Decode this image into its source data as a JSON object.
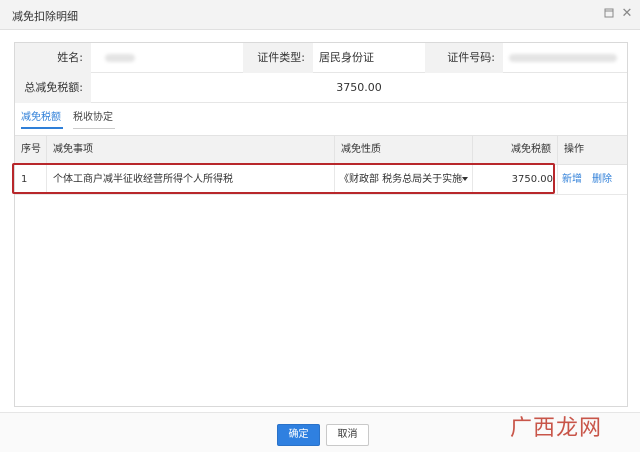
{
  "window": {
    "title": "减免扣除明细"
  },
  "info": {
    "name_label": "姓名:",
    "name_value": "",
    "id_type_label": "证件类型:",
    "id_type_value": "居民身份证",
    "id_number_label": "证件号码:",
    "id_number_value": "",
    "total_label": "总减免税额:",
    "total_value": "3750.00"
  },
  "tabs": [
    {
      "label": "减免税额",
      "active": true
    },
    {
      "label": "税收协定",
      "active": false
    }
  ],
  "grid": {
    "columns": [
      "序号",
      "减免事项",
      "减免性质",
      "减免税额",
      "操作"
    ],
    "rows": [
      {
        "seq": "1",
        "item": "个体工商户减半征收经营所得个人所得税",
        "nature": "《财政部 税务总局关于实施小",
        "amount": "3750.00",
        "actions": [
          "新增",
          "删除"
        ]
      }
    ]
  },
  "footer": {
    "confirm_label": "确定",
    "cancel_label": "取消"
  },
  "watermark": "广西龙网",
  "colors": {
    "accent": "#2f80e0",
    "highlight_border": "#b8272b",
    "label_bg": "#f2f2f2"
  }
}
